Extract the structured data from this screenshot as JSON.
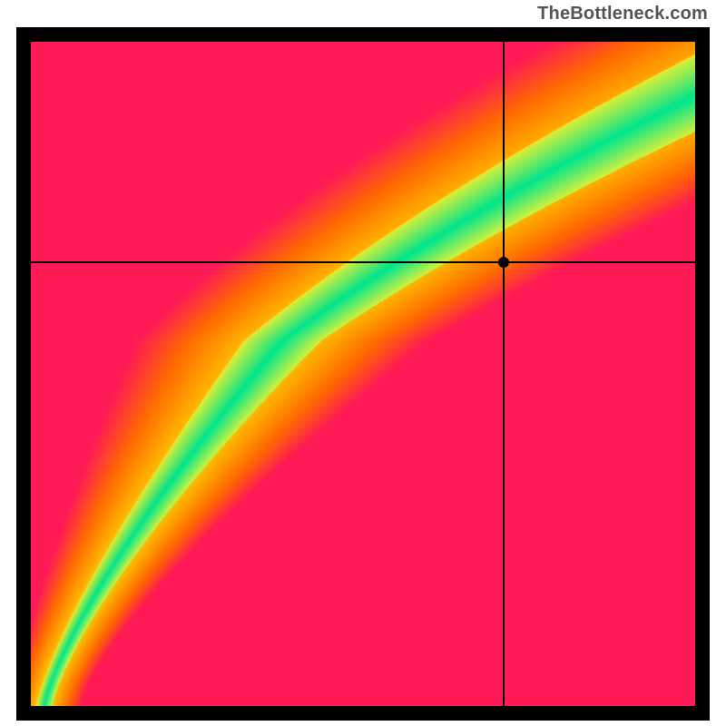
{
  "watermark": "TheBottleneck.com",
  "chart_data": {
    "type": "heatmap",
    "title": "",
    "xlabel": "",
    "ylabel": "",
    "xlim": [
      0,
      1
    ],
    "ylim": [
      0,
      1
    ],
    "legend": false,
    "grid": false,
    "description": "Ideal-band heatmap. Green band marks where the (x, y) ratio is near an ideal curve; color fades through yellow to orange to red as the point deviates from that curve. Black crosshair marks a specific (x, y) sample.",
    "colorscale": [
      {
        "t": 0.0,
        "hex": "#00e58d"
      },
      {
        "t": 0.18,
        "hex": "#d8f03a"
      },
      {
        "t": 0.4,
        "hex": "#ffb000"
      },
      {
        "t": 0.7,
        "hex": "#ff6a00"
      },
      {
        "t": 1.0,
        "hex": "#ff1a55"
      }
    ],
    "ideal_curve": {
      "form": "piecewise-power",
      "comment": "x_ideal as a function of y in [0,1]; lower segment is near-linear, upper segment bends right.",
      "segments": [
        {
          "y0": 0.0,
          "y1": 0.55,
          "x_of_y": "0.02 + 0.78*pow(y,1.30)"
        },
        {
          "y0": 0.55,
          "y1": 1.0,
          "x_of_y": "0.02 + 0.78*pow(0.55,1.30) + (y-0.55)*1.35 + 0.9*pow(y-0.55,2)"
        }
      ]
    },
    "band_halfwidth": {
      "comment": "green band half-width in x units as a function of y",
      "expr": "0.012 + 0.12*pow(y,1.6)"
    },
    "marker": {
      "x": 0.713,
      "y": 0.667
    },
    "crosshair": {
      "x": 0.713,
      "y": 0.667
    }
  }
}
